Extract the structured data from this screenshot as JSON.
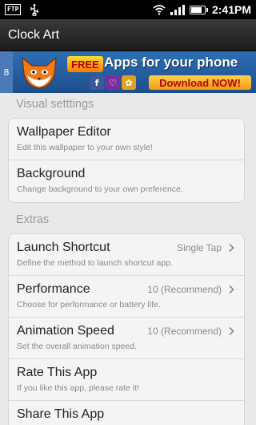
{
  "status_bar": {
    "ftp_label": "FTP",
    "time": "2:41PM"
  },
  "app": {
    "title": "Clock Art"
  },
  "ad": {
    "badge": "8",
    "free_label": "FREE",
    "headline": "Apps for your phone",
    "download_label": "Download NOW!",
    "social_icons": [
      "f",
      "♡",
      "✿"
    ]
  },
  "sections": {
    "visual": {
      "header": "Visual setttings",
      "items": [
        {
          "title": "Wallpaper Editor",
          "subtitle": "Edit this wallpaper to your own style!"
        },
        {
          "title": "Background",
          "subtitle": "Change background to your own preference."
        }
      ]
    },
    "extras": {
      "header": "Extras",
      "items": [
        {
          "title": "Launch Shortcut",
          "subtitle": "Define the method to launch shortcut app.",
          "value": "Single Tap"
        },
        {
          "title": "Performance",
          "subtitle": "Choose for performance or battery life.",
          "value": "10 (Recommend)"
        },
        {
          "title": "Animation Speed",
          "subtitle": "Set the overall animation speed.",
          "value": "10 (Recommend)"
        },
        {
          "title": "Rate This App",
          "subtitle": "If you like this app, please rate it!"
        },
        {
          "title": "Share This App",
          "subtitle": ""
        }
      ]
    }
  },
  "colors": {
    "background": "#e9e9e9",
    "card": "#f4f4f4",
    "ad_blue": "#2d6fb4",
    "ad_orange": "#f39a12"
  }
}
